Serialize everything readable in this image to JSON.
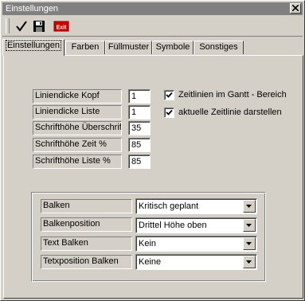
{
  "window": {
    "title": "Einstellungen"
  },
  "toolbar": {
    "check_icon": "checkmark-icon",
    "save_icon": "floppy-disk-icon",
    "exit_label": "Exit",
    "exit_color": "#cc0000"
  },
  "tabs": [
    {
      "label": "Einstellungen",
      "active": true
    },
    {
      "label": "Farben",
      "active": false
    },
    {
      "label": "Füllmuster",
      "active": false
    },
    {
      "label": "Symbole",
      "active": false
    },
    {
      "label": "Sonstiges",
      "active": false
    }
  ],
  "fields": [
    {
      "label": "Liniendicke Kopf",
      "value": "1"
    },
    {
      "label": "Liniendicke Liste",
      "value": "1"
    },
    {
      "label": "Schrifthöhe Überschrift",
      "value": "35"
    },
    {
      "label": "Schrifthöhe Zeit %",
      "value": "85"
    },
    {
      "label": "Schrifthöhe Liste %",
      "value": "85"
    }
  ],
  "checkboxes": [
    {
      "label": "Zeitlinien im Gantt - Bereich",
      "checked": true
    },
    {
      "label": "aktuelle Zeitlinie darstellen",
      "checked": true
    }
  ],
  "bars": [
    {
      "label": "Balken",
      "value": "Kritisch geplant"
    },
    {
      "label": "Balkenposition",
      "value": "Drittel Höhe oben"
    },
    {
      "label": "Text Balken",
      "value": "Kein"
    },
    {
      "label": "Tetxposition Balken",
      "value": "Keine"
    }
  ]
}
